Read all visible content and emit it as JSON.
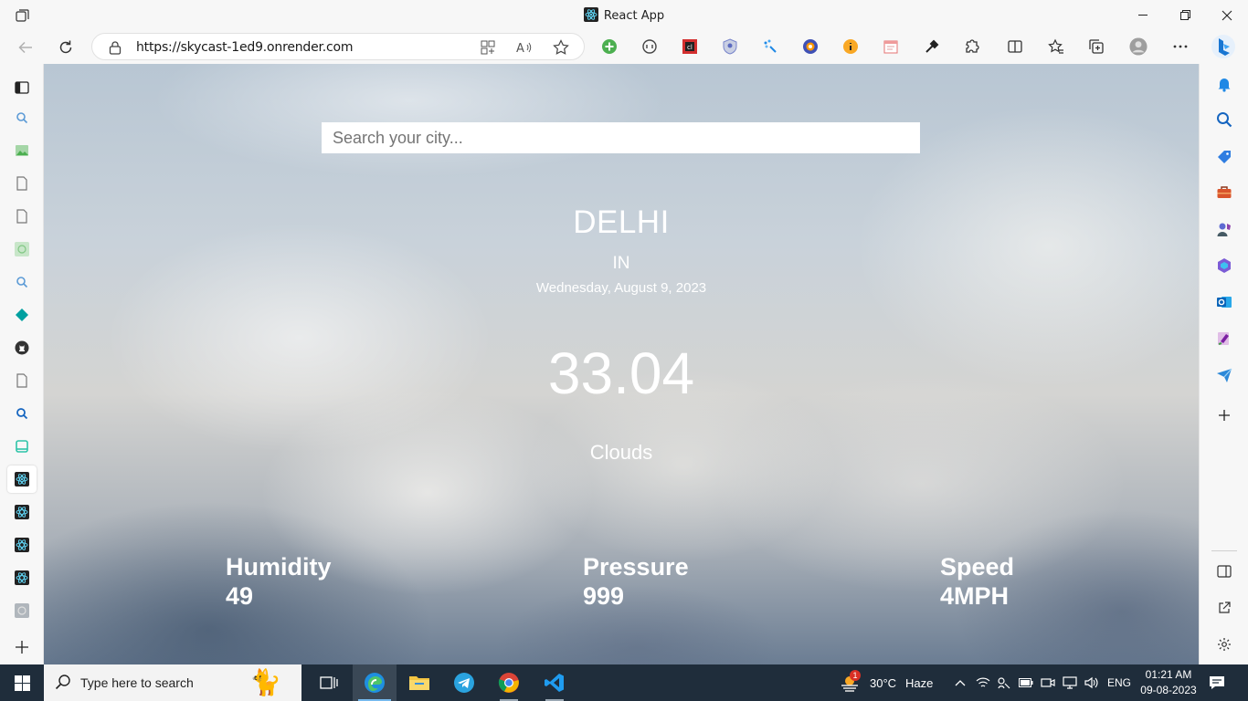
{
  "window": {
    "title": "React App"
  },
  "address_bar": {
    "url": "https://skycast-1ed9.onrender.com"
  },
  "search": {
    "placeholder": "Search your city..."
  },
  "weather": {
    "city": "DELHI",
    "country": "IN",
    "date": "Wednesday, August 9, 2023",
    "temperature": "33.04",
    "condition": "Clouds",
    "stats": [
      {
        "label": "Humidity",
        "value": "49"
      },
      {
        "label": "Pressure",
        "value": "999"
      },
      {
        "label": "Speed",
        "value": "4MPH"
      }
    ]
  },
  "taskbar": {
    "search_placeholder": "Type here to search",
    "weather_temp": "30°C",
    "weather_desc": "Haze",
    "weather_badge": "1",
    "language": "ENG",
    "time": "01:21 AM",
    "date": "09-08-2023"
  },
  "colors": {
    "accent": "#0078d4",
    "taskbar": "#1f2d3b"
  }
}
